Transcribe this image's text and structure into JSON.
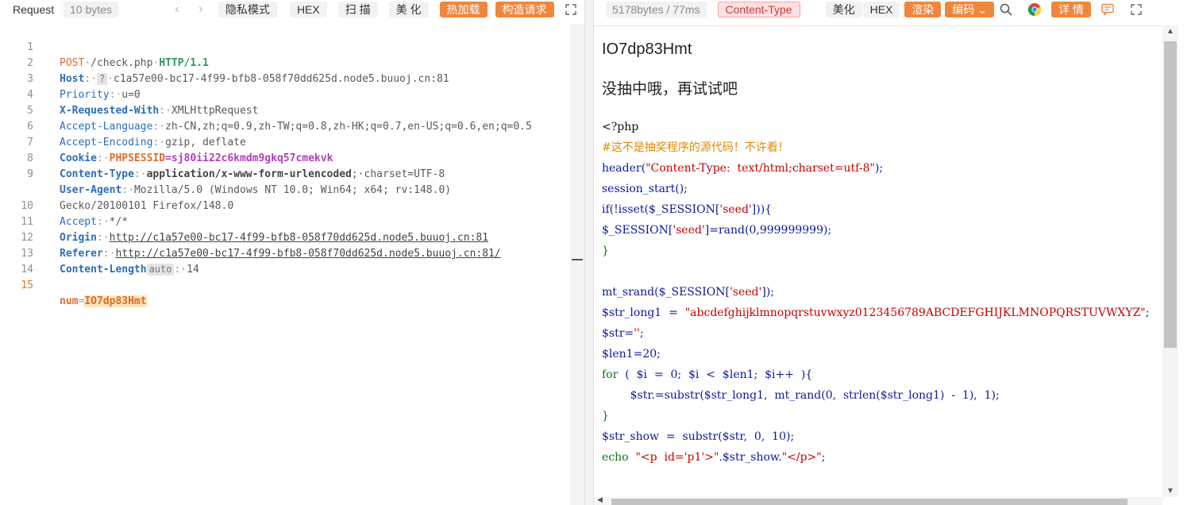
{
  "request": {
    "title": "Request",
    "size_badge": "10 bytes",
    "buttons": {
      "privacy": "隐私模式",
      "hex": "HEX",
      "scan": "扫 描",
      "beautify": "美 化",
      "hotload": "热加载",
      "construct": "构造请求"
    },
    "icons": [
      "chevron-left-icon",
      "chevron-right-icon",
      "expand-icon"
    ],
    "lines": {
      "l1": {
        "method": "POST",
        "path": "/check.php",
        "proto": "HTTP/1.1"
      },
      "l2": {
        "key": "Host",
        "hint": "?",
        "value": "c1a57e00-bc17-4f99-bfb8-058f70dd625d.node5.buuoj.cn:81"
      },
      "l3": {
        "key": "Priority",
        "value": "u=0"
      },
      "l4": {
        "key": "X-Requested-With",
        "value": "XMLHttpRequest"
      },
      "l5": {
        "key": "Accept-Language",
        "value": "zh-CN,zh;q=0.9,zh-TW;q=0.8,zh-HK;q=0.7,en-US;q=0.6,en;q=0.5"
      },
      "l6": {
        "key": "Accept-Encoding",
        "value": "gzip, deflate"
      },
      "l7": {
        "key": "Cookie",
        "cookie_name": "PHPSESSID",
        "cookie_value": "sj80ii22c6kmdm9gkq57cmekvk"
      },
      "l8": {
        "key": "Content-Type",
        "value": "application/x-www-form-urlencoded",
        "extra": "charset=UTF-8"
      },
      "l9": {
        "key": "User-Agent",
        "value": "Mozilla/5.0 (Windows NT 10.0; Win64; x64; rv:148.0) Gecko/20100101 Firefox/148.0"
      },
      "l10": {
        "key": "Accept",
        "value": "*/*"
      },
      "l11": {
        "key": "Origin",
        "value": "http://c1a57e00-bc17-4f99-bfb8-058f70dd625d.node5.buuoj.cn:81"
      },
      "l12": {
        "key": "Referer",
        "value": "http://c1a57e00-bc17-4f99-bfb8-058f70dd625d.node5.buuoj.cn:81/"
      },
      "l13": {
        "key": "Content-Length",
        "auto": "auto",
        "value": "14"
      },
      "l15": {
        "param": "num",
        "value": "IO7dp83Hmt"
      }
    },
    "line_numbers": [
      "1",
      "2",
      "3",
      "4",
      "5",
      "6",
      "7",
      "8",
      "9",
      "10",
      "11",
      "12",
      "13",
      "14",
      "15"
    ]
  },
  "response": {
    "stats": "5178bytes / 77ms",
    "buttons": {
      "content_type": "Content-Type",
      "beautify": "美化",
      "hex": "HEX",
      "render": "渲染",
      "encode": "编码",
      "detail": "详 情"
    },
    "icons": [
      "search-icon",
      "chrome-icon",
      "comment-icon",
      "expand-icon"
    ],
    "heading": "IO7dp83Hmt",
    "subtitle": "没抽中哦，再试试吧",
    "php": {
      "open": "<?php",
      "comment": "#这不是抽奖程序的源代码！不许看！",
      "header_fn": "header(",
      "header_arg": "\"Content-Type:  text/html;charset=utf-8\"",
      "header_end": ");",
      "session_start": "session_start();",
      "if_open": "if(!isset($_SESSION[",
      "seed1": "'seed'",
      "if_close": "])){",
      "sess_assign": "$_SESSION[",
      "seed2": "'seed'",
      "rand": "]=rand(0,999999999);",
      "brace1": "}",
      "srand_open": "mt_srand($_SESSION[",
      "seed3": "'seed'",
      "srand_close": "]);",
      "strlong_var": "$str_long1  =  ",
      "strlong_val": "\"abcdefghijklmnopqrstuvwxyz0123456789ABCDEFGHIJKLMNOPQRSTUVWXYZ\"",
      "semicolon": ";",
      "str_var": "$str=",
      "str_val": "''",
      "str_end": ";",
      "len_line": "$len1=20;",
      "for_kw": "for",
      "for_rest": "  (  $i  =  0;  $i  <  $len1;  $i++  ){",
      "loop_body": "        $str.=substr($str_long1,  mt_rand(0,  strlen($str_long1)  -  1),  1);",
      "brace2": "}",
      "show_line": "$str_show  =  substr($str,  0,  10);",
      "echo_kw": "echo",
      "echo_sp": "  ",
      "echo_s1": "\"<p  id='p1'>\"",
      "echo_mid": ".$str_show.",
      "echo_s2": "\"</p>\"",
      "echo_end": ";"
    }
  },
  "colors": {
    "accent_orange": "#f0863c",
    "method": "#e06c2e",
    "header_key": "#2a6ebd",
    "cookie_value": "#b33dbf",
    "php_keyword": "#0b1a9c",
    "php_comment": "#e08a00",
    "php_string": "#c80000",
    "php_control": "#0a7a0a"
  }
}
